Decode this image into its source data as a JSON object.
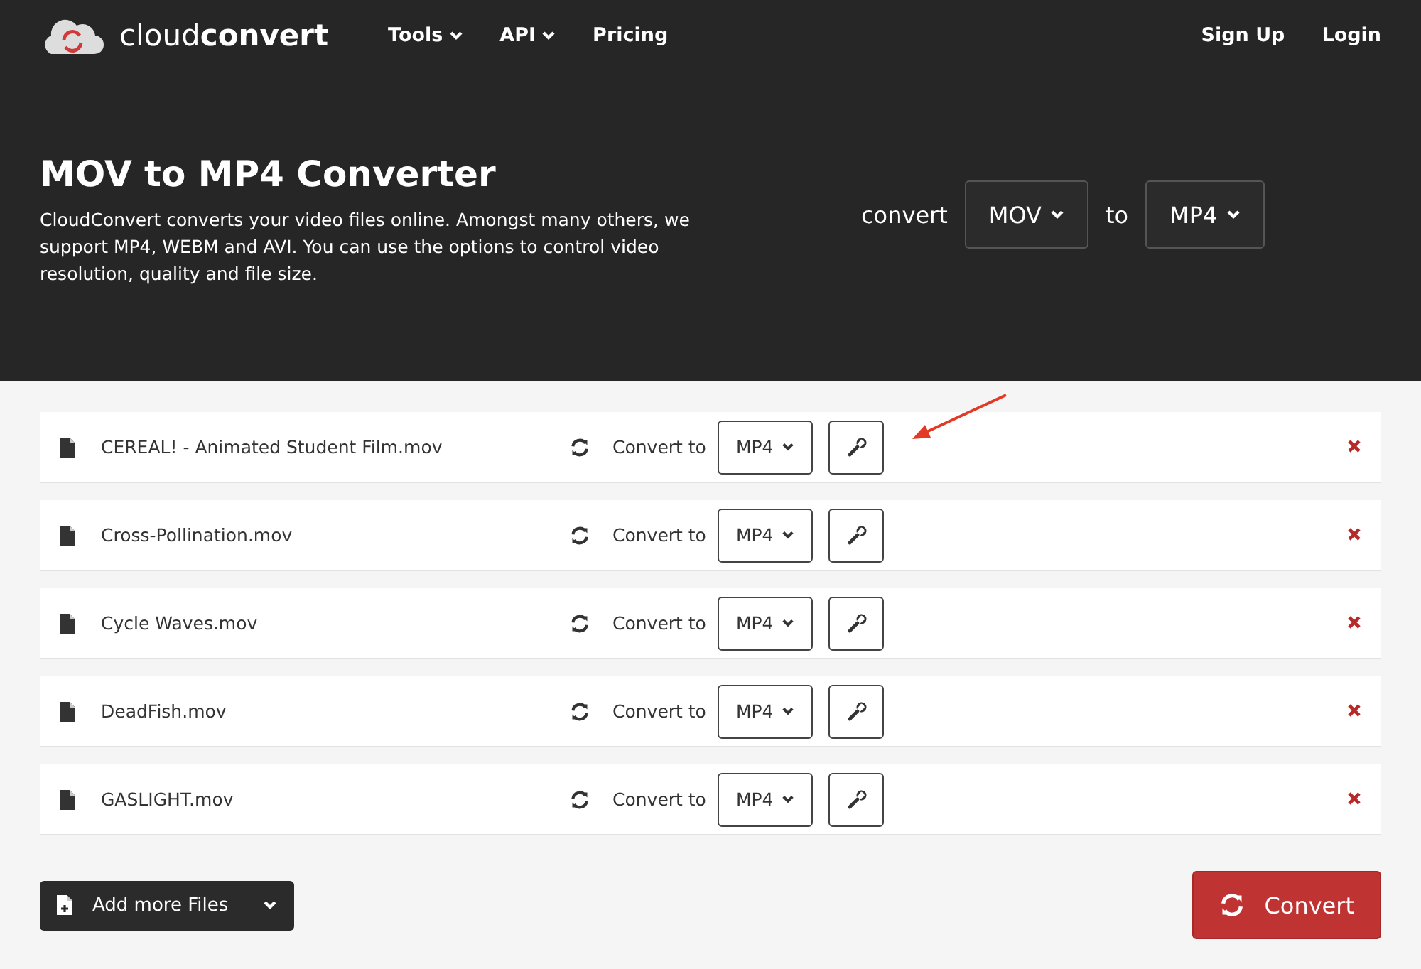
{
  "header": {
    "logo": "cloud**convert**",
    "nav": [
      {
        "label": "Tools",
        "dropdown": true
      },
      {
        "label": "API",
        "dropdown": true
      },
      {
        "label": "Pricing",
        "dropdown": false
      }
    ],
    "account": [
      "Sign Up",
      "Login"
    ]
  },
  "hero": {
    "title": "MOV to MP4 Converter",
    "description": "CloudConvert converts your video files online. Amongst many others, we support MP4, WEBM and AVI. You can use the options to control video resolution, quality and file size.",
    "convert_label": "convert",
    "from": "MOV",
    "to_label": "to",
    "to": "MP4"
  },
  "files": [
    {
      "name": "CEREAL! - Animated Student Film.mov",
      "convert_label": "Convert to",
      "format": "MP4",
      "highlighted": true
    },
    {
      "name": "Cross-Pollination.mov",
      "convert_label": "Convert to",
      "format": "MP4",
      "highlighted": false
    },
    {
      "name": "Cycle Waves.mov",
      "convert_label": "Convert to",
      "format": "MP4",
      "highlighted": false
    },
    {
      "name": "DeadFish.mov",
      "convert_label": "Convert to",
      "format": "MP4",
      "highlighted": false
    },
    {
      "name": "GASLIGHT.mov",
      "convert_label": "Convert to",
      "format": "MP4",
      "highlighted": false
    }
  ],
  "add_button": "Add more Files",
  "convert_button": "Convert"
}
